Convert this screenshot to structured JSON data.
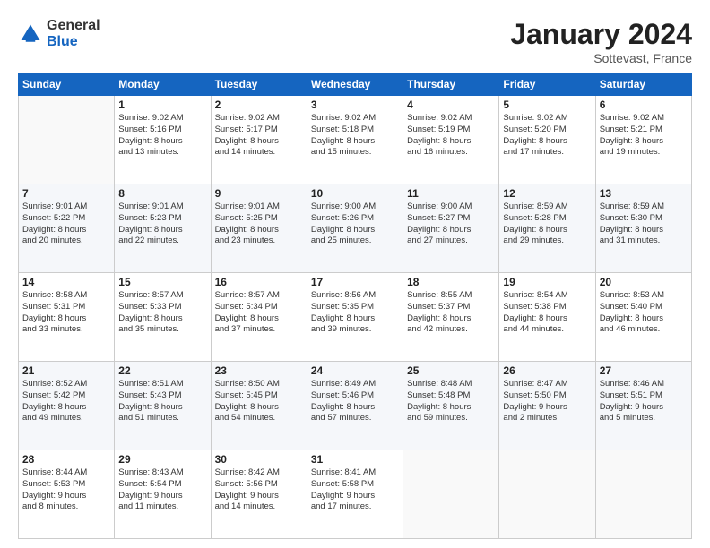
{
  "logo": {
    "general": "General",
    "blue": "Blue"
  },
  "header": {
    "month": "January 2024",
    "location": "Sottevast, France"
  },
  "weekdays": [
    "Sunday",
    "Monday",
    "Tuesday",
    "Wednesday",
    "Thursday",
    "Friday",
    "Saturday"
  ],
  "weeks": [
    [
      {
        "day": "",
        "info": ""
      },
      {
        "day": "1",
        "info": "Sunrise: 9:02 AM\nSunset: 5:16 PM\nDaylight: 8 hours\nand 13 minutes."
      },
      {
        "day": "2",
        "info": "Sunrise: 9:02 AM\nSunset: 5:17 PM\nDaylight: 8 hours\nand 14 minutes."
      },
      {
        "day": "3",
        "info": "Sunrise: 9:02 AM\nSunset: 5:18 PM\nDaylight: 8 hours\nand 15 minutes."
      },
      {
        "day": "4",
        "info": "Sunrise: 9:02 AM\nSunset: 5:19 PM\nDaylight: 8 hours\nand 16 minutes."
      },
      {
        "day": "5",
        "info": "Sunrise: 9:02 AM\nSunset: 5:20 PM\nDaylight: 8 hours\nand 17 minutes."
      },
      {
        "day": "6",
        "info": "Sunrise: 9:02 AM\nSunset: 5:21 PM\nDaylight: 8 hours\nand 19 minutes."
      }
    ],
    [
      {
        "day": "7",
        "info": "Sunrise: 9:01 AM\nSunset: 5:22 PM\nDaylight: 8 hours\nand 20 minutes."
      },
      {
        "day": "8",
        "info": "Sunrise: 9:01 AM\nSunset: 5:23 PM\nDaylight: 8 hours\nand 22 minutes."
      },
      {
        "day": "9",
        "info": "Sunrise: 9:01 AM\nSunset: 5:25 PM\nDaylight: 8 hours\nand 23 minutes."
      },
      {
        "day": "10",
        "info": "Sunrise: 9:00 AM\nSunset: 5:26 PM\nDaylight: 8 hours\nand 25 minutes."
      },
      {
        "day": "11",
        "info": "Sunrise: 9:00 AM\nSunset: 5:27 PM\nDaylight: 8 hours\nand 27 minutes."
      },
      {
        "day": "12",
        "info": "Sunrise: 8:59 AM\nSunset: 5:28 PM\nDaylight: 8 hours\nand 29 minutes."
      },
      {
        "day": "13",
        "info": "Sunrise: 8:59 AM\nSunset: 5:30 PM\nDaylight: 8 hours\nand 31 minutes."
      }
    ],
    [
      {
        "day": "14",
        "info": "Sunrise: 8:58 AM\nSunset: 5:31 PM\nDaylight: 8 hours\nand 33 minutes."
      },
      {
        "day": "15",
        "info": "Sunrise: 8:57 AM\nSunset: 5:33 PM\nDaylight: 8 hours\nand 35 minutes."
      },
      {
        "day": "16",
        "info": "Sunrise: 8:57 AM\nSunset: 5:34 PM\nDaylight: 8 hours\nand 37 minutes."
      },
      {
        "day": "17",
        "info": "Sunrise: 8:56 AM\nSunset: 5:35 PM\nDaylight: 8 hours\nand 39 minutes."
      },
      {
        "day": "18",
        "info": "Sunrise: 8:55 AM\nSunset: 5:37 PM\nDaylight: 8 hours\nand 42 minutes."
      },
      {
        "day": "19",
        "info": "Sunrise: 8:54 AM\nSunset: 5:38 PM\nDaylight: 8 hours\nand 44 minutes."
      },
      {
        "day": "20",
        "info": "Sunrise: 8:53 AM\nSunset: 5:40 PM\nDaylight: 8 hours\nand 46 minutes."
      }
    ],
    [
      {
        "day": "21",
        "info": "Sunrise: 8:52 AM\nSunset: 5:42 PM\nDaylight: 8 hours\nand 49 minutes."
      },
      {
        "day": "22",
        "info": "Sunrise: 8:51 AM\nSunset: 5:43 PM\nDaylight: 8 hours\nand 51 minutes."
      },
      {
        "day": "23",
        "info": "Sunrise: 8:50 AM\nSunset: 5:45 PM\nDaylight: 8 hours\nand 54 minutes."
      },
      {
        "day": "24",
        "info": "Sunrise: 8:49 AM\nSunset: 5:46 PM\nDaylight: 8 hours\nand 57 minutes."
      },
      {
        "day": "25",
        "info": "Sunrise: 8:48 AM\nSunset: 5:48 PM\nDaylight: 8 hours\nand 59 minutes."
      },
      {
        "day": "26",
        "info": "Sunrise: 8:47 AM\nSunset: 5:50 PM\nDaylight: 9 hours\nand 2 minutes."
      },
      {
        "day": "27",
        "info": "Sunrise: 8:46 AM\nSunset: 5:51 PM\nDaylight: 9 hours\nand 5 minutes."
      }
    ],
    [
      {
        "day": "28",
        "info": "Sunrise: 8:44 AM\nSunset: 5:53 PM\nDaylight: 9 hours\nand 8 minutes."
      },
      {
        "day": "29",
        "info": "Sunrise: 8:43 AM\nSunset: 5:54 PM\nDaylight: 9 hours\nand 11 minutes."
      },
      {
        "day": "30",
        "info": "Sunrise: 8:42 AM\nSunset: 5:56 PM\nDaylight: 9 hours\nand 14 minutes."
      },
      {
        "day": "31",
        "info": "Sunrise: 8:41 AM\nSunset: 5:58 PM\nDaylight: 9 hours\nand 17 minutes."
      },
      {
        "day": "",
        "info": ""
      },
      {
        "day": "",
        "info": ""
      },
      {
        "day": "",
        "info": ""
      }
    ]
  ]
}
